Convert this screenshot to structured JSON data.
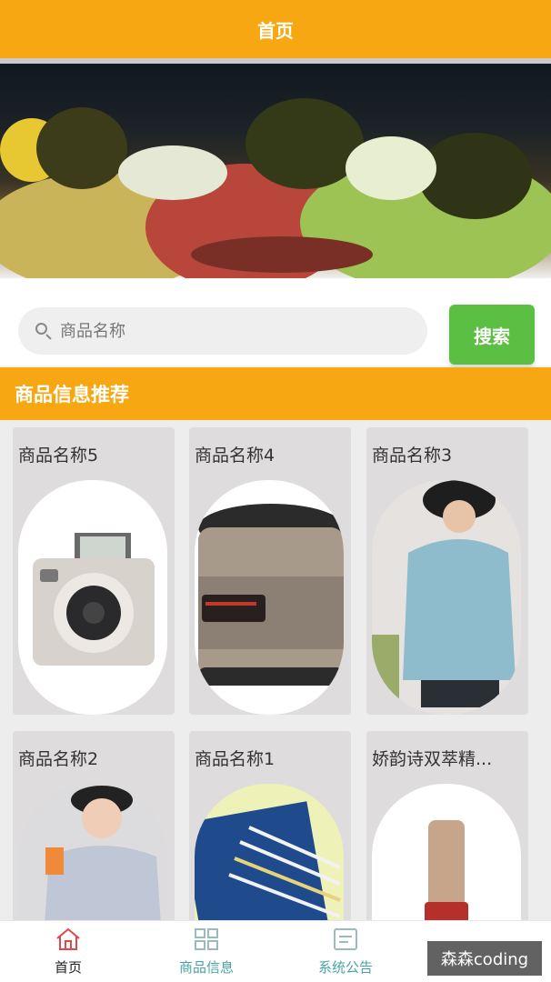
{
  "header": {
    "title": "首页"
  },
  "search": {
    "placeholder": "商品名称",
    "button_label": "搜索"
  },
  "section": {
    "title": "商品信息推荐"
  },
  "products": [
    {
      "name": "商品名称5"
    },
    {
      "name": "商品名称4"
    },
    {
      "name": "商品名称3"
    },
    {
      "name": "商品名称2"
    },
    {
      "name": "商品名称1"
    },
    {
      "name": "娇韵诗双萃精..."
    }
  ],
  "tabbar": {
    "items": [
      {
        "label": "首页",
        "icon": "home-icon",
        "active": true
      },
      {
        "label": "商品信息",
        "icon": "grid-icon",
        "active": false
      },
      {
        "label": "系统公告",
        "icon": "notice-icon",
        "active": false
      }
    ]
  },
  "watermark": {
    "text": "森森coding"
  },
  "colors": {
    "accent": "#f7a711",
    "search_button": "#5bbf43",
    "tab_active": "#e0494a",
    "tab_inactive": "#4aa3a8"
  }
}
